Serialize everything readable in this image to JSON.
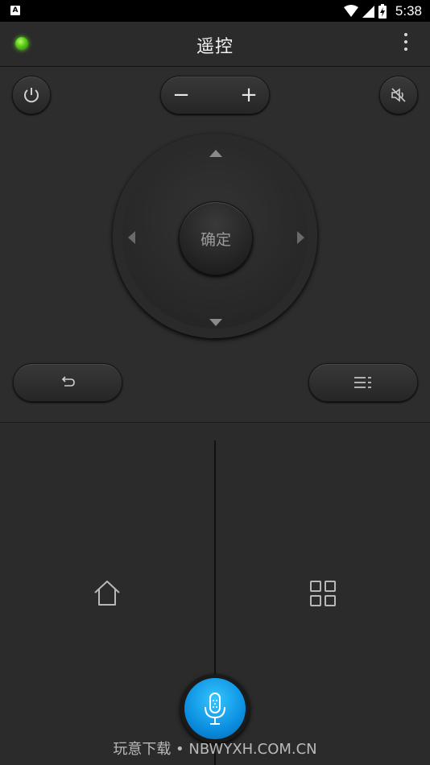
{
  "status_bar": {
    "time": "5:38",
    "app_badge": "A"
  },
  "header": {
    "title": "遥控"
  },
  "remote": {
    "ok_label": "确定",
    "volume_minus": "−",
    "volume_plus": "+"
  },
  "watermark": "玩意下载 • NBWYXH.COM.CN",
  "colors": {
    "accent": "#0c8fe0",
    "led": "#58c81a",
    "background": "#2b2b2b"
  }
}
